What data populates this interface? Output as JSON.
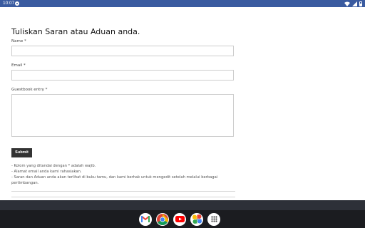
{
  "status_bar": {
    "time": "10:07"
  },
  "form": {
    "title": "Tuliskan Saran atau Aduan anda.",
    "name_label": "Name *",
    "name_value": "",
    "email_label": "Email *",
    "email_value": "",
    "entry_label": "Guestbook entry *",
    "entry_value": "",
    "submit_label": "Submit"
  },
  "notes": [
    "- Kolom yang ditandai dengan * adalah wajib.",
    "- Alamat email anda kami rahasiakan.",
    "- Saran dan Aduan anda akan terlihat di buku tamu, dan kami berhak untuk mengedit setelah melalui berbagai pertimbangan."
  ],
  "dock": {
    "apps": [
      "gmail-icon",
      "chrome-icon",
      "youtube-icon",
      "photos-icon",
      "app-drawer-icon"
    ]
  },
  "colors": {
    "status_bar": "#3a5ba0",
    "submit_button": "#333333",
    "taskbar": "#1b1c20"
  }
}
